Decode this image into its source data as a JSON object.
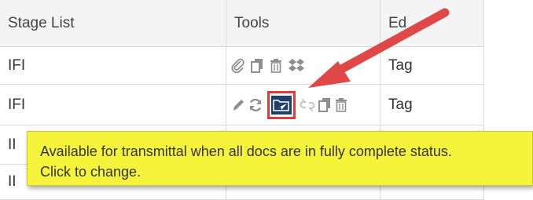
{
  "table": {
    "headers": {
      "stage_list": "Stage List",
      "tools": "Tools",
      "edit_partial": "Ed"
    },
    "rows": [
      {
        "stage": "IFI",
        "edit": "Tag"
      },
      {
        "stage": "IFI",
        "edit": "Tag"
      },
      {
        "stage": "II",
        "edit": ""
      },
      {
        "stage": "II",
        "edit": ""
      }
    ]
  },
  "tooltip": {
    "line1": "Available for transmittal when all docs are in fully complete status.",
    "line2": "Click to change."
  },
  "colors": {
    "tooltip_bg": "#f5f33a",
    "highlight_border": "#e03b3b",
    "arrow": "#e04848",
    "transmittal_icon_bg": "#1f3f66"
  },
  "icons": {
    "row1": [
      "paperclip-icon",
      "copy-icon",
      "trash-icon",
      "dropbox-icon"
    ],
    "row2": [
      "pencil-icon",
      "refresh-icon",
      "transmittal-folder-icon",
      "unlink-icon",
      "copy-icon",
      "trash-icon"
    ]
  }
}
